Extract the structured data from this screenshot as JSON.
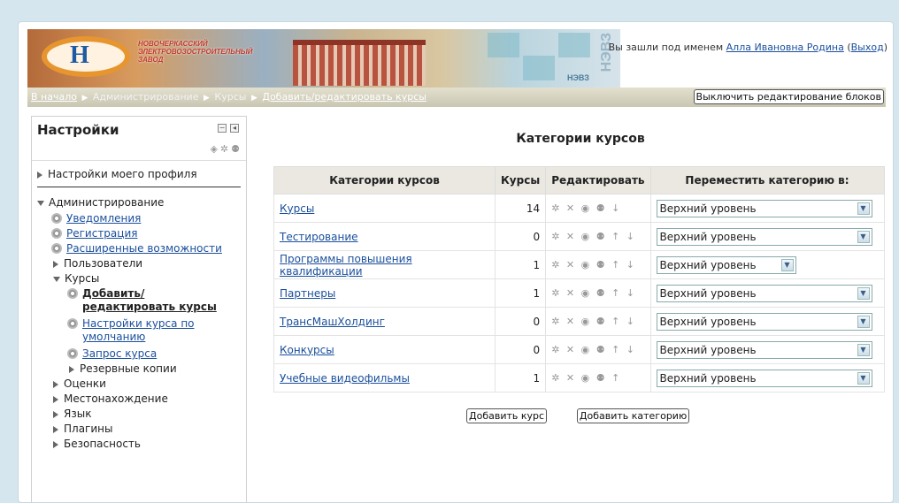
{
  "header": {
    "logo_lines": [
      "НОВОЧЕРКАССКИЙ",
      "ЭЛЕКТРОВОЗОСТРОИТЕЛЬНЫЙ",
      "ЗАВОД"
    ],
    "brand_letters": "НЭВЗ",
    "login_prefix": "Вы зашли под именем",
    "user_name": "Алла Ивановна Родина",
    "logout_open": "(",
    "logout": "Выход",
    "logout_close": ")"
  },
  "breadcrumb": [
    {
      "label": "В начало",
      "link": true
    },
    {
      "label": "Администрирование",
      "link": false
    },
    {
      "label": "Курсы",
      "link": false
    },
    {
      "label": "Добавить/редактировать курсы",
      "link": true
    }
  ],
  "edit_blocks_label": "Выключить редактирование блоков",
  "settings": {
    "title": "Настройки",
    "profile": "Настройки моего профиля",
    "admin": "Администрирование",
    "items": [
      {
        "label": "Уведомления",
        "type": "gear-link"
      },
      {
        "label": "Регистрация",
        "type": "gear-link"
      },
      {
        "label": "Расширенные возможности",
        "type": "gear-link"
      },
      {
        "label": "Пользователи",
        "type": "collapsed"
      }
    ],
    "courses": "Курсы",
    "course_items": [
      {
        "label": "Добавить/редактировать курсы",
        "current": true
      },
      {
        "label": "Настройки курса по умолчанию",
        "current": false
      },
      {
        "label": "Запрос курса",
        "current": false
      }
    ],
    "backups": "Резервные копии",
    "rest": [
      "Оценки",
      "Местонахождение",
      "Язык",
      "Плагины",
      "Безопасность"
    ]
  },
  "main": {
    "title": "Категории курсов",
    "columns": [
      "Категории курсов",
      "Курсы",
      "Редактировать",
      "Переместить категорию в:"
    ],
    "rows": [
      {
        "name": "Курсы",
        "count": "14",
        "icons": "✲ ✕ ◉ ⚉ ↓",
        "move": "Верхний уровень"
      },
      {
        "name": "Тестирование",
        "count": "0",
        "icons": "✲ ✕ ◉ ⚉ ↑ ↓",
        "move": "Верхний уровень"
      },
      {
        "name": "Программы повышения квалификации",
        "count": "1",
        "icons": "✲ ✕ ◉ ⚉ ↑ ↓",
        "move": "Верхний уровень"
      },
      {
        "name": "Партнеры",
        "count": "1",
        "icons": "✲ ✕ ◉ ⚉ ↑ ↓",
        "move": "Верхний уровень"
      },
      {
        "name": "ТрансМашХолдинг",
        "count": "0",
        "icons": "✲ ✕ ◉ ⚉ ↑ ↓",
        "move": "Верхний уровень"
      },
      {
        "name": "Конкурсы",
        "count": "0",
        "icons": "✲ ✕ ◉ ⚉ ↑ ↓",
        "move": "Верхний уровень"
      },
      {
        "name": "Учебные видеофильмы",
        "count": "1",
        "icons": "✲ ✕ ◉ ⚉ ↑",
        "move": "Верхний уровень"
      }
    ],
    "add_course": "Добавить курс",
    "add_category": "Добавить категорию"
  }
}
